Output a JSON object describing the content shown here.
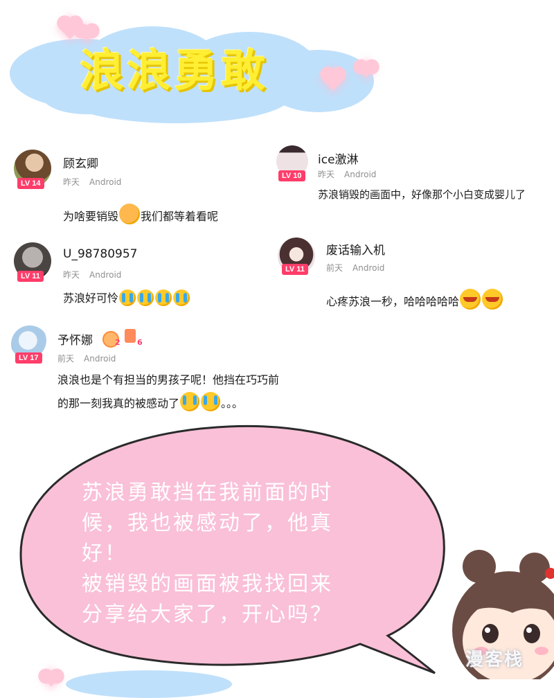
{
  "header": {
    "title": "浪浪勇敢"
  },
  "comments": [
    {
      "user": "顾玄卿",
      "level": "LV 14",
      "time": "昨天",
      "device": "Android",
      "text_parts": [
        "为啥要销毁",
        "我们都等着看呢"
      ]
    },
    {
      "user": "ice激淋",
      "level": "LV 10",
      "time": "昨天",
      "device": "Android",
      "text": "苏浪销毁的画面中，好像那个小白变成婴儿了"
    },
    {
      "user": "U_98780957",
      "level": "LV 11",
      "time": "昨天",
      "device": "Android",
      "text": "苏浪好可怜"
    },
    {
      "user": "废话输入机",
      "level": "LV 11",
      "time": "前天",
      "device": "Android",
      "text": "心疼苏浪一秒，哈哈哈哈哈"
    },
    {
      "user": "予怀娜",
      "level": "LV 17",
      "time": "前天",
      "device": "Android",
      "badges": [
        "2",
        "6"
      ],
      "line1": "浪浪也是个有担当的男孩子呢！他挡在巧巧前",
      "line2": "的那一刻我真的被感动了",
      "line2_end": "。。。"
    }
  ],
  "bubble": {
    "lines": [
      "苏浪勇敢挡在我前面的时",
      "候，我也被感动了，他真",
      "好！",
      "被销毁的画面被我找回来",
      "分享给大家了，开心吗？"
    ]
  },
  "watermark": "漫客栈",
  "colors": {
    "cloud": "#bfe0fb",
    "title": "#ffee33",
    "bubble": "#f9c0d7",
    "level_badge": "#ff3d6a"
  },
  "icons": [
    "heart-icon",
    "emoji-dizzy-icon",
    "emoji-cry-icon",
    "emoji-laugh-icon",
    "monkey-badge-icon",
    "gift-badge-icon"
  ]
}
